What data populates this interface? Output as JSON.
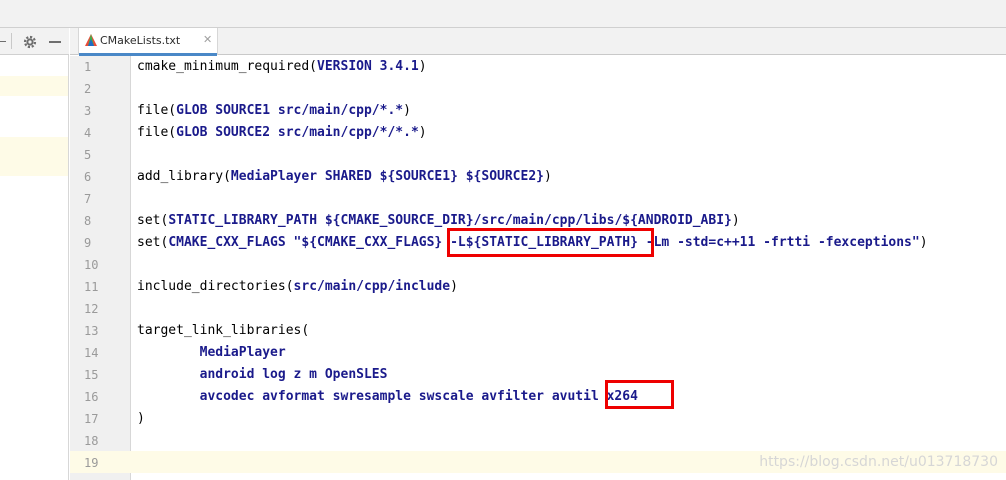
{
  "tab": {
    "label": "CMakeLists.txt",
    "close": "✕"
  },
  "line_numbers": [
    "1",
    "2",
    "3",
    "4",
    "5",
    "6",
    "7",
    "8",
    "9",
    "10",
    "11",
    "12",
    "13",
    "14",
    "15",
    "16",
    "17",
    "18",
    "19"
  ],
  "code": {
    "l1_a": "cmake_minimum_required(",
    "l1_b": "VERSION 3.4.1",
    "l1_c": ")",
    "l3_a": "file(",
    "l3_b": "GLOB SOURCE1 src/main/cpp/*.*",
    "l3_c": ")",
    "l4_a": "file(",
    "l4_b": "GLOB SOURCE2 src/main/cpp/*/*.*",
    "l4_c": ")",
    "l6_a": "add_library(",
    "l6_b": "MediaPlayer SHARED ${SOURCE1} ${SOURCE2}",
    "l6_c": ")",
    "l8_a": "set(",
    "l8_b": "STATIC_LIBRARY_PATH ${CMAKE_SOURCE_DIR}",
    "l8_c": "/src/main/cpp/libs/",
    "l8_d": "${ANDROID_ABI}",
    "l8_e": ")",
    "l9_a": "set(",
    "l9_b": "CMAKE_CXX_FLAGS ",
    "l9_c": "\"${CMAKE_CXX_FLAGS} ",
    "l9_d": "-L${STATIC_LIBRARY_PATH}",
    "l9_e": " -Lm -std=c++11 -frtti -fexceptions\"",
    "l9_f": ")",
    "l11_a": "include_directories(",
    "l11_b": "src/main/cpp/include",
    "l11_c": ")",
    "l13": "target_link_libraries(",
    "l14": "        MediaPlayer",
    "l15": "        android log z m OpenSLES",
    "l16_a": "        avcodec avformat swresample swscale avfilter avutil ",
    "l16_b": "x264",
    "l17": ")"
  },
  "watermark": "https://blog.csdn.net/u013718730",
  "colors": {
    "annotation": "#ee0000",
    "keyword": "#1a1a8b",
    "current_line": "#fefbe7"
  }
}
